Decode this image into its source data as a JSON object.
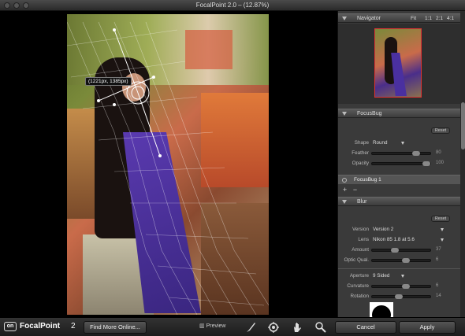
{
  "window": {
    "title": "FocalPoint 2.0 –  (12.87%)"
  },
  "canvas": {
    "coords_label": "(1221px, 1385px)"
  },
  "navigator": {
    "title": "Navigator",
    "zoom_options": [
      "Fit",
      "1:1",
      "2:1",
      "4:1"
    ]
  },
  "focusbug": {
    "title": "FocusBug",
    "reset": "Reset",
    "shape_label": "Shape",
    "shape_value": "Round",
    "feather_label": "Feather",
    "feather_value": "80",
    "feather_level": 0.8,
    "opacity_label": "Opacity",
    "opacity_value": "100",
    "opacity_level": 1.0,
    "layer_name": "FocusBug 1",
    "add": "+",
    "remove": "−"
  },
  "blur": {
    "title": "Blur",
    "reset": "Reset",
    "version_label": "Version",
    "version_value": "Version 2",
    "lens_label": "Lens",
    "lens_value": "Nikon 85 1.8 at 5.6",
    "amount_label": "Amount",
    "amount_value": "37",
    "amount_level": 0.37,
    "optic_label": "Optic Qual.",
    "optic_value": "6",
    "optic_level": 0.6,
    "aperture_label": "Aperture",
    "aperture_value": "9 Sided",
    "curvature_label": "Curvature",
    "curvature_value": "6",
    "curvature_level": 0.6,
    "rotation_label": "Rotation",
    "rotation_value": "14",
    "rotation_level": 0.45
  },
  "bottombar": {
    "logo_mark": "on",
    "logo_name": "FocalPoint",
    "logo_version": "2",
    "find_more": "Find More Online...",
    "preview": "Preview",
    "cancel": "Cancel",
    "apply": "Apply"
  }
}
